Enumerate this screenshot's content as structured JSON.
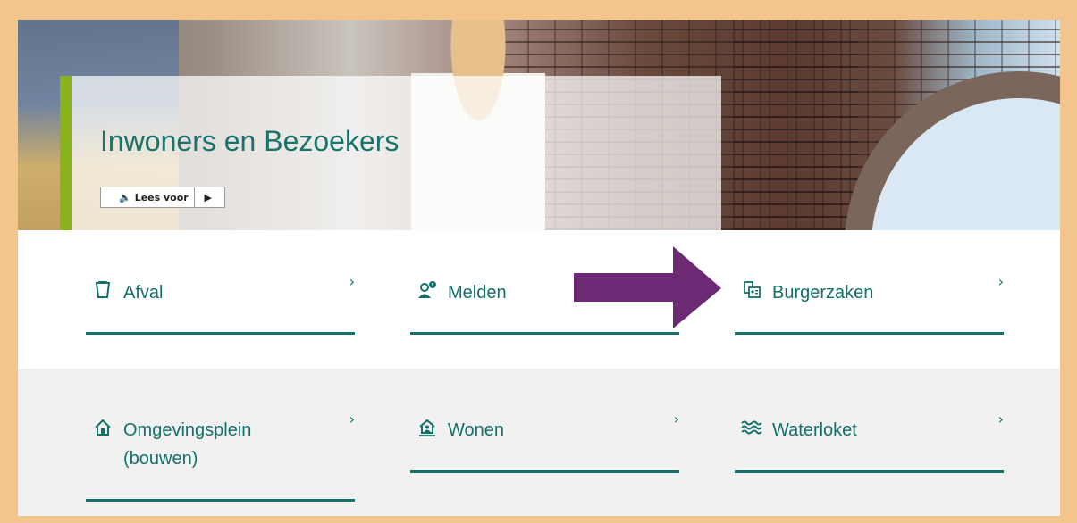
{
  "hero": {
    "title": "Inwoners en Bezoekers",
    "read_aloud": {
      "label": "Lees voor",
      "speaker_icon": "speaker-icon",
      "play_icon": "play-icon"
    }
  },
  "tiles": [
    {
      "label": "Afval",
      "icon": "trash-icon"
    },
    {
      "label": "Melden",
      "icon": "person-alert-icon"
    },
    {
      "label": "Burgerzaken",
      "icon": "id-document-icon"
    },
    {
      "label": "Omgevingsplein",
      "label2": "(bouwen)",
      "icon": "house-icon"
    },
    {
      "label": "Wonen",
      "icon": "house-person-icon"
    },
    {
      "label": "Waterloket",
      "icon": "waves-icon"
    }
  ],
  "chevron": "›",
  "annotation": {
    "arrow_color": "#6b2a73"
  },
  "colors": {
    "accent": "#127168",
    "title": "#19736b",
    "green_bar": "#8ab31b",
    "frame": "#f3c58d"
  }
}
